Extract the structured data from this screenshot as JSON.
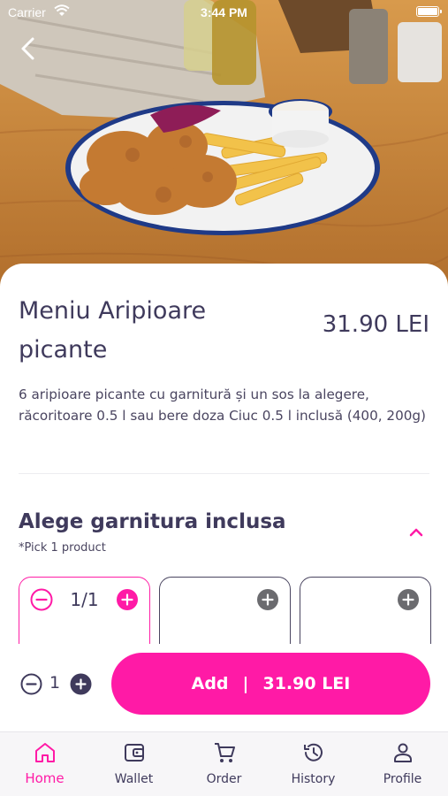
{
  "status_bar": {
    "carrier": "Carrier",
    "time": "3:44 PM"
  },
  "product": {
    "title": "Meniu Aripioare picante",
    "price": "31.90 LEI",
    "description": "6 aripioare picante cu garnitură și un sos la alegere, răcoritoare 0.5 l sau bere doza Ciuc 0.5 l inclusă (400, 200g)"
  },
  "garnish_section": {
    "title": "Alege garnitura inclusa",
    "note": "*Pick 1 product",
    "options": [
      {
        "count": "1/1",
        "selected": true
      },
      {
        "count": "",
        "selected": false
      },
      {
        "count": "",
        "selected": false
      }
    ]
  },
  "add_bar": {
    "quantity": "1",
    "add_label": "Add",
    "separator": "|",
    "total": "31.90 LEI"
  },
  "tabs": [
    {
      "label": "Home",
      "icon": "home-icon",
      "active": true
    },
    {
      "label": "Wallet",
      "icon": "wallet-icon",
      "active": false
    },
    {
      "label": "Order",
      "icon": "cart-icon",
      "active": false
    },
    {
      "label": "History",
      "icon": "history-icon",
      "active": false
    },
    {
      "label": "Profile",
      "icon": "person-icon",
      "active": false
    }
  ],
  "colors": {
    "accent": "#ff1aa6",
    "text": "#3f3a5c",
    "tab_bg": "#f7f6f8"
  }
}
